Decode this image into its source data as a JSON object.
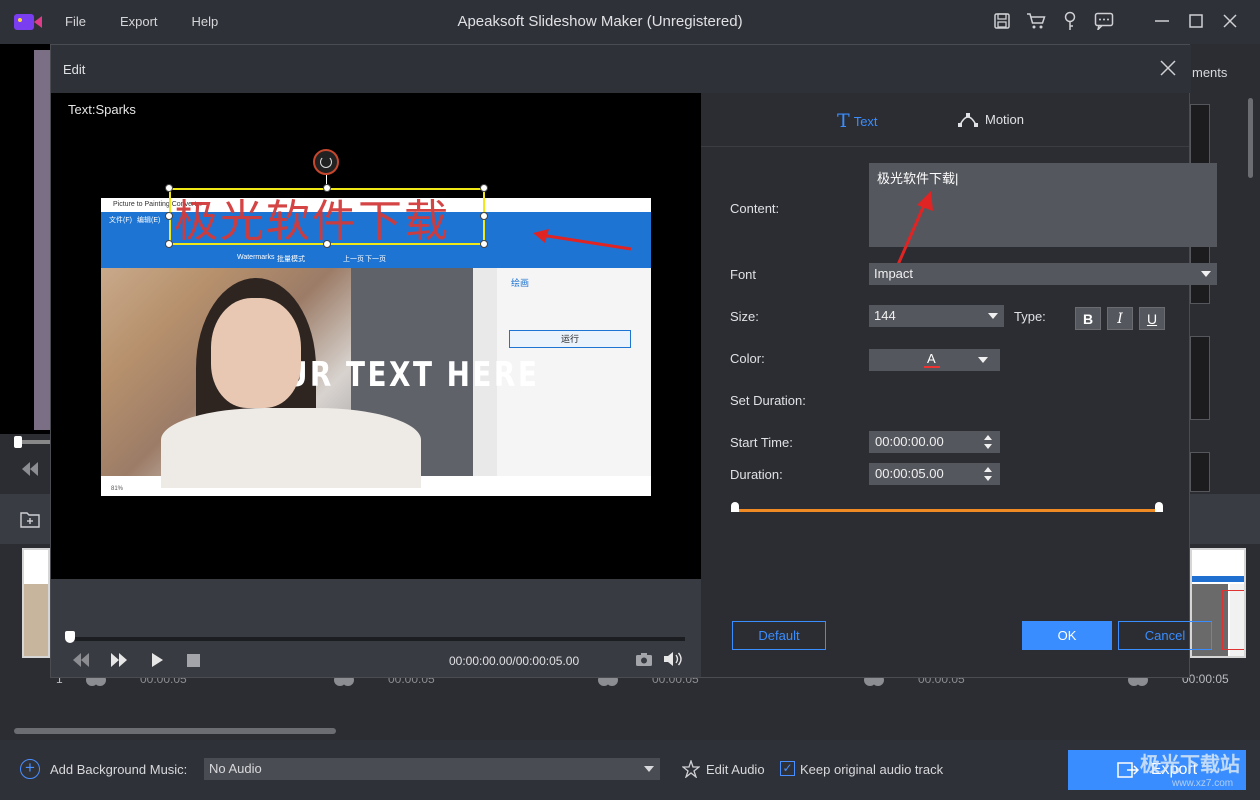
{
  "app": {
    "title": "Apeaksoft Slideshow Maker (Unregistered)",
    "menu": [
      "File",
      "Export",
      "Help"
    ]
  },
  "background": {
    "right_label": "ments",
    "timeline": [
      {
        "index": "1",
        "time": "00:00:05"
      },
      {
        "time": "00:00:05"
      },
      {
        "time": "00:00:05"
      },
      {
        "time": "00:00:05"
      },
      {
        "time": "00:00:05"
      }
    ]
  },
  "dialog": {
    "title": "Edit",
    "preview_label": "Text:Sparks",
    "overlay_text": "YOUR  TEXT  HERE",
    "chinese_overlay": "极光软件下载",
    "time_readout": "00:00:00.00/00:00:05.00",
    "inner_screenshot": {
      "title": "Picture to Painting Converter",
      "tabs": [
        "文件(F)",
        "编辑(E)",
        "Watermarks",
        "批量模式",
        "上一页",
        "下一页"
      ],
      "panel_heading": "绘画",
      "run_label": "运行",
      "status": "81%"
    },
    "tabs": {
      "text": "Text",
      "motion": "Motion"
    },
    "fields": {
      "content_label": "Content:",
      "content_value": "极光软件下载",
      "font_label": "Font",
      "font_value": "Impact",
      "size_label": "Size:",
      "size_value": "144",
      "type_label": "Type:",
      "bold": "B",
      "italic": "I",
      "underline": "U",
      "color_label": "Color:",
      "color_letter": "A",
      "duration_label": "Set Duration:",
      "start_label": "Start Time:",
      "start_value": "00:00:00.00",
      "dur_label": "Duration:",
      "dur_value": "00:00:05.00"
    },
    "buttons": {
      "default": "Default",
      "ok": "OK",
      "cancel": "Cancel"
    },
    "colors": {
      "accent": "#3a8dff",
      "range": "#f08a24"
    }
  },
  "bottom": {
    "add_music_label": "Add Background Music:",
    "audio_value": "No Audio",
    "edit_audio_label": "Edit Audio",
    "keep_label": "Keep original audio track",
    "export_label": "Export",
    "keep_checked": true
  },
  "watermark": {
    "brand": "极光下载站",
    "url": "www.xz7.com"
  }
}
